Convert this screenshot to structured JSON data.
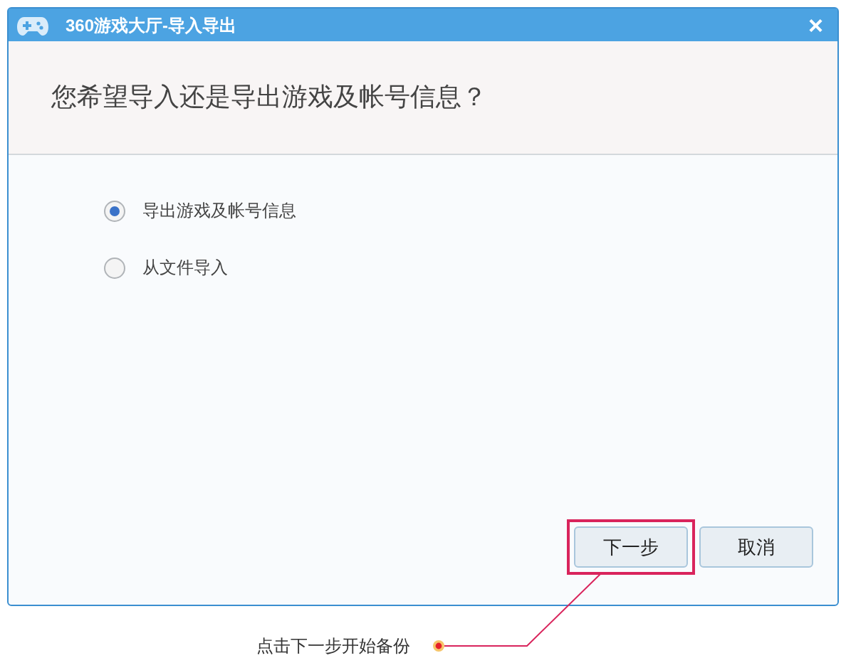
{
  "window": {
    "title": "360游戏大厅-导入导出",
    "close": "×"
  },
  "question": "您希望导入还是导出游戏及帐号信息？",
  "options": [
    {
      "label": "导出游戏及帐号信息",
      "selected": true
    },
    {
      "label": "从文件导入",
      "selected": false
    }
  ],
  "buttons": [
    {
      "label": "下一步",
      "highlighted": true
    },
    {
      "label": "取消",
      "highlighted": false
    }
  ],
  "annotation": {
    "text": "点击下一步开始备份"
  }
}
